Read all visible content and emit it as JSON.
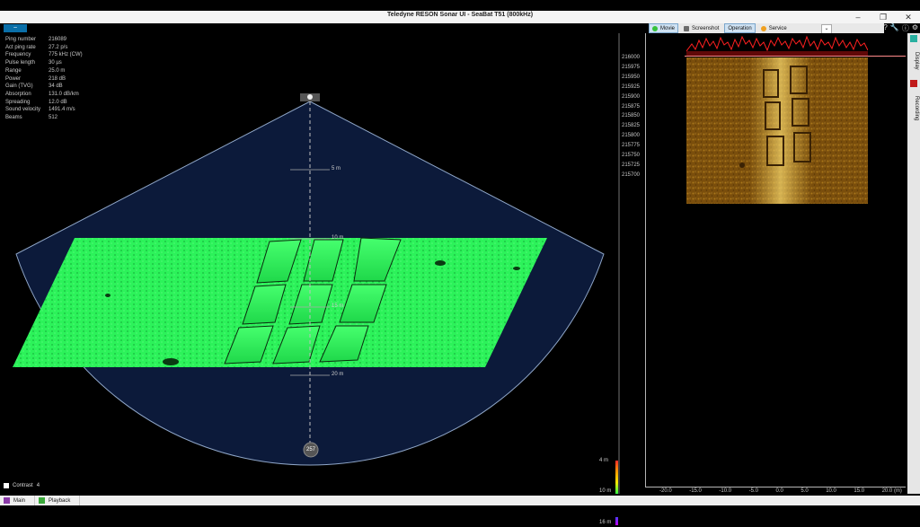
{
  "window": {
    "title": "Teledyne RESON Sonar UI - SeaBat T51 (800kHz)",
    "controls": [
      "–",
      "❐",
      "✕"
    ]
  },
  "toolbar": {
    "logo": "~",
    "buttons": [
      {
        "label": "Movie",
        "active": true,
        "icon_color": "#35c23b"
      },
      {
        "label": "Screenshot",
        "active": false,
        "icon_color": "#6c6c6c"
      },
      {
        "label": "Operation",
        "active": true,
        "icon_color": "#ffffff"
      },
      {
        "label": "Service",
        "active": false,
        "icon_color": "#f0a020"
      }
    ],
    "dropdown_arrow": "⌄",
    "icons": [
      "?",
      "🔧",
      "ⓘ",
      "⚙"
    ]
  },
  "sonar_info": [
    {
      "key": "Ping number",
      "value": "216089"
    },
    {
      "key": "Act ping rate",
      "value": "27.2 p/s"
    },
    {
      "key": "Frequency",
      "value": "775 kHz (CW)"
    },
    {
      "key": "Pulse length",
      "value": "30 µs"
    },
    {
      "key": "Range",
      "value": "25.0 m"
    },
    {
      "key": "Power",
      "value": "218 dB"
    },
    {
      "key": "Gain (TVG)",
      "value": "34 dB"
    },
    {
      "key": "Absorption",
      "value": "131.0 dB/km"
    },
    {
      "key": "Spreading",
      "value": "12.0 dB"
    },
    {
      "key": "Sound velocity",
      "value": "1491.4 m/s"
    },
    {
      "key": "Beams",
      "value": "512"
    }
  ],
  "sonar_view": {
    "range_labels": [
      "5 m",
      "10 m",
      "15 m",
      "20 m"
    ],
    "beam_number": "257",
    "colors": {
      "fan": "#0c1a3a",
      "seafloor": "#2aff52",
      "fan_edge": "#8fa6c8"
    }
  },
  "depth_scale": {
    "labels": [
      "4 m",
      "10 m",
      "16 m"
    ]
  },
  "waterfall": {
    "ping_labels": [
      "216000",
      "215975",
      "215950",
      "215925",
      "215900",
      "215875",
      "215850",
      "215825",
      "215800",
      "215775",
      "215750",
      "215725",
      "215700"
    ],
    "x_labels": [
      "-20.0",
      "-15.0",
      "-10.0",
      "-5.0",
      "0.0",
      "5.0",
      "10.0",
      "15.0",
      "20.0 (m)"
    ]
  },
  "side_tabs": [
    "Display",
    "Recording"
  ],
  "bottom": {
    "contrast_label": "Contrast",
    "contrast_value": "4",
    "tabs": [
      {
        "label": "Main",
        "icon_color": "#8a3aa8"
      },
      {
        "label": "Playback",
        "icon_color": "#3aa83a"
      }
    ]
  }
}
